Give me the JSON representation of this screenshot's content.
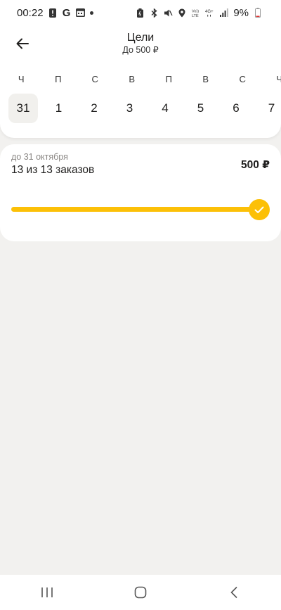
{
  "status_bar": {
    "time": "00:22",
    "battery": "9%",
    "icons": [
      "alert-icon",
      "google-icon",
      "calendar-icon",
      "dot-icon",
      "battery-saver-icon",
      "bluetooth-icon",
      "mute-icon",
      "location-icon",
      "volte-icon",
      "4g-icon",
      "signal-icon",
      "battery-icon"
    ]
  },
  "header": {
    "title": "Цели",
    "subtitle": "До 500 ₽"
  },
  "calendar": {
    "weekdays": [
      "Ч",
      "П",
      "С",
      "В",
      "П",
      "В",
      "С",
      "Ч"
    ],
    "dates": [
      "31",
      "1",
      "2",
      "3",
      "4",
      "5",
      "6",
      "7"
    ],
    "selected_index": 0
  },
  "goal": {
    "deadline": "до 31 октября",
    "progress_text": "13 из 13 заказов",
    "amount": "500 ₽",
    "progress_fraction": 1.0,
    "accent_color": "#fcc007"
  },
  "navbar": {
    "icons": [
      "recent-apps-icon",
      "home-icon",
      "back-icon"
    ]
  }
}
